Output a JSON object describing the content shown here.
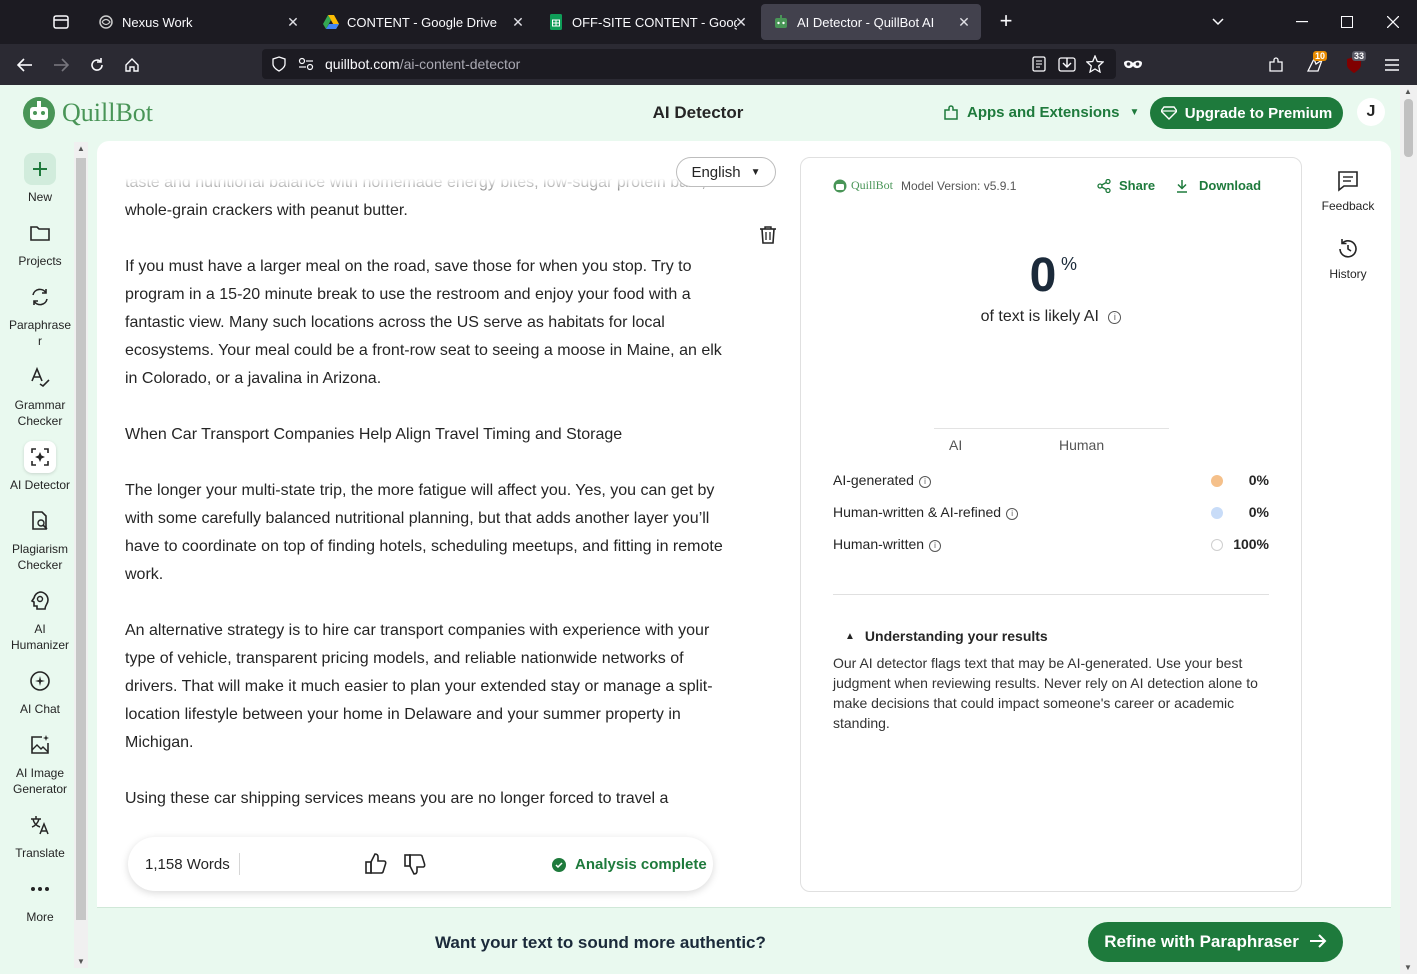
{
  "browser": {
    "tabs": [
      {
        "title": "Nexus Work",
        "icon": "nexus-icon",
        "active": false
      },
      {
        "title": "CONTENT - Google Drive",
        "icon": "google-drive-icon",
        "active": false
      },
      {
        "title": "OFF-SITE CONTENT - Google Sh",
        "icon": "google-sheets-icon",
        "active": false
      },
      {
        "title": "AI Detector - QuillBot AI",
        "icon": "quillbot-icon",
        "active": true
      }
    ],
    "url_domain": "quillbot.com",
    "url_path": "/ai-content-detector",
    "ext_badge_1": "10",
    "ext_badge_2": "33"
  },
  "header": {
    "logo_text": "QuillBot",
    "title": "AI Detector",
    "apps_label": "Apps and Extensions",
    "upgrade_label": "Upgrade to Premium",
    "avatar_initial": "J"
  },
  "sidebar": {
    "items": [
      {
        "label": "New",
        "icon": "plus-icon"
      },
      {
        "label": "Projects",
        "icon": "folder-icon"
      },
      {
        "label": "Paraphraser",
        "icon": "paraphrase-icon"
      },
      {
        "label": "Grammar Checker",
        "icon": "grammar-icon"
      },
      {
        "label": "AI Detector",
        "icon": "ai-detector-icon"
      },
      {
        "label": "Plagiarism Checker",
        "icon": "plagiarism-icon"
      },
      {
        "label": "AI Humanizer",
        "icon": "humanizer-icon"
      },
      {
        "label": "AI Chat",
        "icon": "chat-icon"
      },
      {
        "label": "AI Image Generator",
        "icon": "image-generator-icon"
      },
      {
        "label": "Translate",
        "icon": "translate-icon"
      },
      {
        "label": "More",
        "icon": "more-icon"
      }
    ]
  },
  "editor": {
    "language": "English",
    "paragraphs": [
      "avoid anything that requires a lot of hands while driving, but can still get a satisfying taste and nutritional balance with homemade energy bites, low-sugar protein bars, or whole-grain crackers with peanut butter.",
      "If you must have a larger meal on the road, save those for when you stop. Try to program in a 15-20 minute break to use the restroom and enjoy your food with a fantastic view. Many such locations across the US serve as habitats for local ecosystems. Your meal could be a front-row seat to seeing a moose in Maine, an elk in Colorado, or a javalina in Arizona.",
      "When Car Transport Companies Help Align Travel Timing and Storage",
      "The longer your multi-state trip, the more fatigue will affect you. Yes, you can get by with some carefully balanced nutritional planning, but that adds another layer you’ll have to coordinate on top of finding hotels, scheduling meetups, and fitting in remote work.",
      "An alternative strategy is to hire car transport companies with experience with your type of vehicle, transparent pricing models, and reliable nationwide networks of drivers. That will make it much easier to plan your extended stay or manage a split-location lifestyle between your home in Delaware and your summer property in Michigan.",
      "Using these car shipping services means you are no longer forced to travel a"
    ],
    "word_count": "1,158 Words",
    "status": "Analysis complete"
  },
  "results": {
    "brand": "QuillBot",
    "model_version": "Model Version: v5.9.1",
    "share_label": "Share",
    "download_label": "Download",
    "score": "0",
    "score_unit": "%",
    "score_caption": "of text is likely AI",
    "axis_ai": "AI",
    "axis_human": "Human",
    "rows": [
      {
        "name": "AI-generated",
        "pct": "0%",
        "color": "#f5c08a"
      },
      {
        "name": "Human-written & AI-refined",
        "pct": "0%",
        "color": "#c8dcf8"
      },
      {
        "name": "Human-written",
        "pct": "100%",
        "color": "#ffffff"
      }
    ],
    "understanding_title": "Understanding your results",
    "understanding_text": "Our AI detector flags text that may be AI-generated. Use your best judgment when reviewing results. Never rely on AI detection alone to make decisions that could impact someone's career or academic standing."
  },
  "right_rail": {
    "feedback_label": "Feedback",
    "history_label": "History"
  },
  "footer": {
    "prompt": "Want your text to sound more authentic?",
    "cta": "Refine with Paraphraser"
  },
  "colors": {
    "brand_green": "#1e7a3c",
    "page_bg": "#e9f9ef"
  }
}
